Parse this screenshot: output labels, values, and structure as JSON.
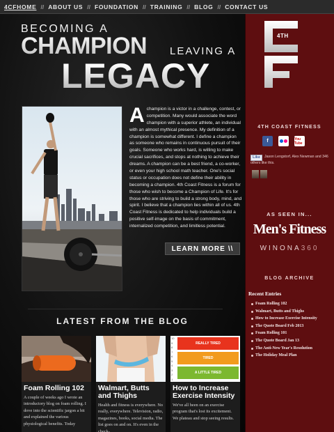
{
  "nav": {
    "items": [
      "4CFHOME",
      "ABOUT US",
      "FOUNDATION",
      "TRAINING",
      "BLOG",
      "CONTACT US"
    ],
    "separator": "//"
  },
  "hero": {
    "line1": "BECOMING A",
    "line2": "CHAMPION",
    "line3": "LEAVING A",
    "line4": "LEGACY"
  },
  "intro": {
    "drop_cap": "A",
    "text": "champion is a victor in a challenge, contest, or competition. Many would associate the word champion with a superior athlete, an individual with an almost mythical presence. My definition of a champion is somewhat different. I define a champion as someone who remains in continuous pursuit of their goals. Someone who works hard, is willing to make crucial sacrifices, and stops at nothing to achieve their dreams. A champion can be a best friend, a co-worker, or even your high school math teacher. One's social status or occupation does not define their ability in becoming a champion. 4th Coast Fitness is a forum for those who wish to become a Champion of Life. It's for those who are striving to build a strong body, mind, and spirit. I believe that a champion lies within all of us. 4th Coast Fitness is dedicated to help individuals build a positive self-image on the basis of commitment, internalized competition, and limitless potential.",
    "button": "LEARN MORE",
    "button_icon": "\\\\"
  },
  "blog": {
    "heading": "LATEST FROM THE BLOG",
    "cards": [
      {
        "title": "Foam Rolling 102",
        "excerpt": "A couple of weeks ago I wrote an introductory blog on foam rolling. I dove into the scientific jargon a bit and explained the various physiological benefits. Today"
      },
      {
        "title": "Walmart, Butts and Thighs",
        "excerpt": "Health and fitness is everywhere. No really, everywhere. Television, radio, magazines, books, social media. The list goes on and on. It's even in the check-"
      },
      {
        "title": "How to Increase Exercise Intensity",
        "excerpt": "We've all been on an exercise program that's lost its excitement. We plateau and stop seeing results."
      }
    ],
    "chart_labels": [
      "REALLY TIRED",
      "TIRED",
      "A LITTLE TIRED"
    ],
    "chart_numbers": [
      "10",
      "9",
      "8",
      "7",
      "6",
      "5",
      "4",
      "3",
      "2",
      "1"
    ]
  },
  "sidebar": {
    "logo_text": "4TH",
    "brand": "4TH COAST FITNESS",
    "social": {
      "facebook": "f",
      "flickr": "●●",
      "youtube": "You Tube"
    },
    "like_button": "Like",
    "like_text": "Jason Lengstorf, Alex Newman and 346 others like this.",
    "seen_in": "AS SEEN IN...",
    "mens_fitness": "Men's Fitness",
    "winona": "WINONA",
    "winona_num": "360",
    "archive": "BLOG ARCHIVE",
    "recent": "Recent Entries",
    "entries": [
      "Foam Rolling 102",
      "Walmart, Butts and Thighs",
      "How to Increase Exercise Intensity",
      "The Quote Board Feb 2013",
      "Foam Rolling 101",
      "The Quote Board Jan 13",
      "The Anti-New Year's Resolution",
      "The Holiday Meal Plan"
    ]
  },
  "colors": {
    "sidebar": "#5e0e10",
    "chart_red": "#e8331d",
    "chart_orange": "#f29b1d",
    "chart_yellow": "#f2c81d",
    "chart_green": "#7cb82f"
  }
}
